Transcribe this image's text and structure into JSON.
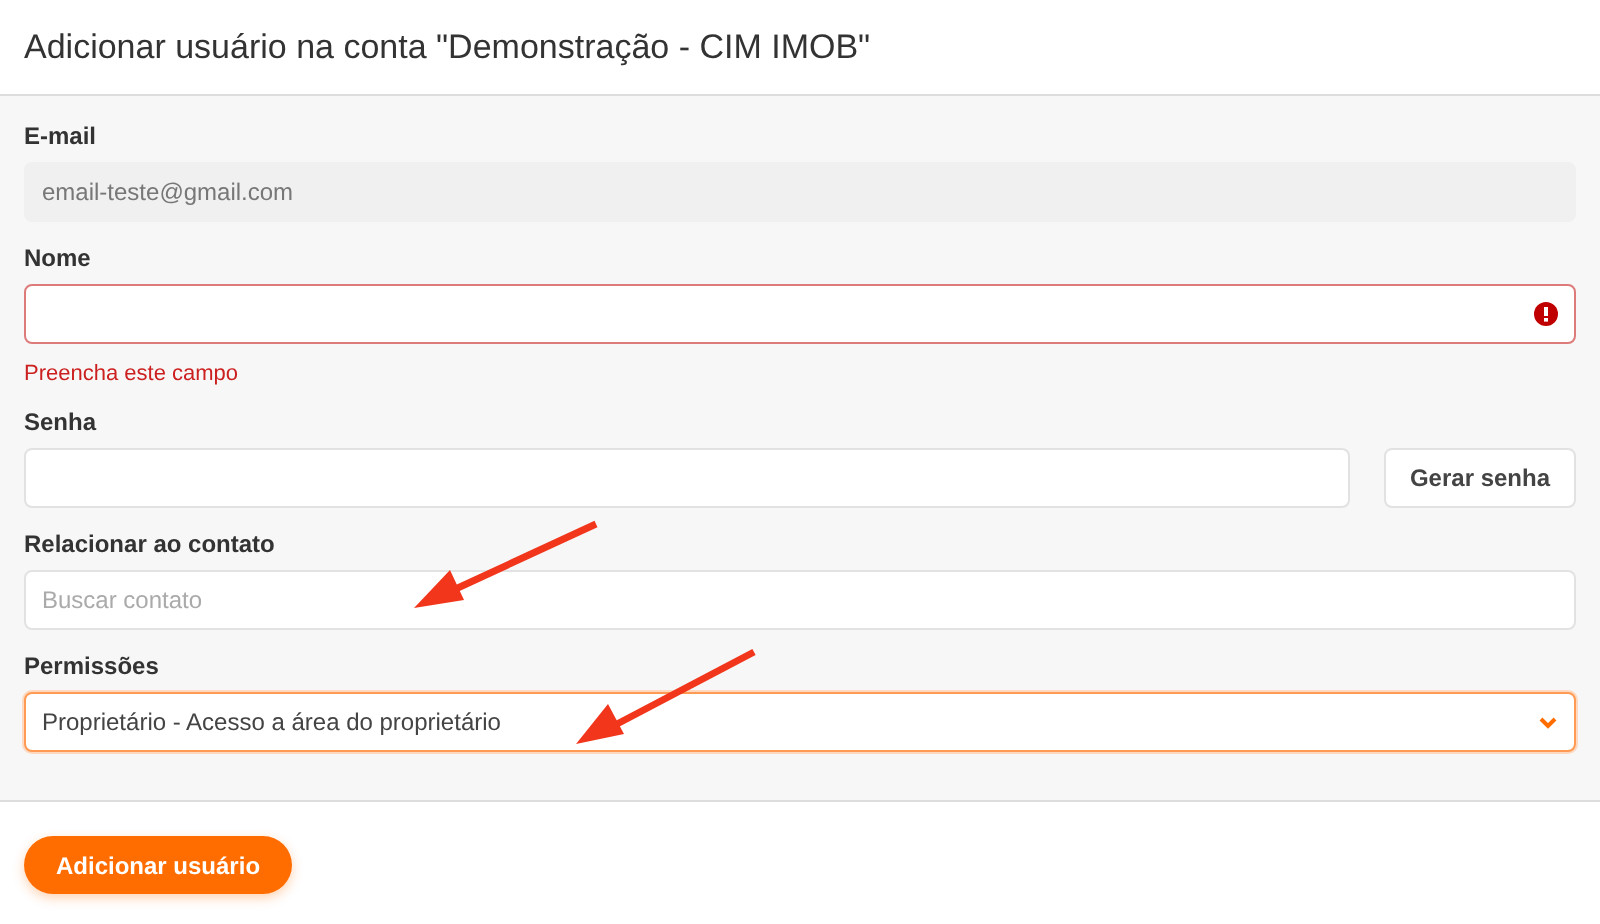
{
  "dialog": {
    "title": "Adicionar usuário na conta \"Demonstração - CIM IMOB\""
  },
  "fields": [
    {
      "kind": "readonly",
      "label": "E-mail",
      "value": "email-teste@gmail.com"
    },
    {
      "kind": "text",
      "label": "Nome",
      "invalid": true,
      "focused": false,
      "error": "Preencha este campo"
    },
    {
      "kind": "password",
      "label": "Senha",
      "invalid": false,
      "focused": false,
      "button": "Gerar senha"
    },
    {
      "kind": "text",
      "label": "Relacionar ao contato",
      "placeholder": "Buscar contato",
      "invalid": false,
      "focused": false
    },
    {
      "kind": "select",
      "label": "Permissões",
      "value": "Proprietário - Acesso a área do proprietário",
      "invalid": false,
      "focused": true
    }
  ],
  "submit_button": "Adicionar usuário"
}
